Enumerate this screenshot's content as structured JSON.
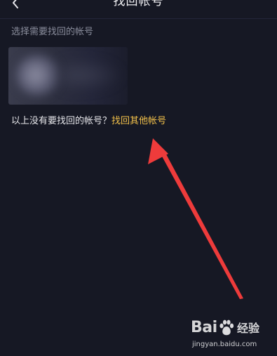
{
  "header": {
    "title": "找回帐号",
    "back_icon": "chevron-left-icon"
  },
  "account_list": {
    "label": "选择需要找回的帐号"
  },
  "other_account": {
    "prompt": "以上没有要找回的帐号？",
    "link": "找回其他帐号"
  },
  "watermark": {
    "brand": "Bai",
    "product": "经验",
    "url": "jingyan.baidu.com"
  },
  "colors": {
    "background": "#161824",
    "link": "#f2c04a",
    "arrow": "#ee3b3b"
  }
}
